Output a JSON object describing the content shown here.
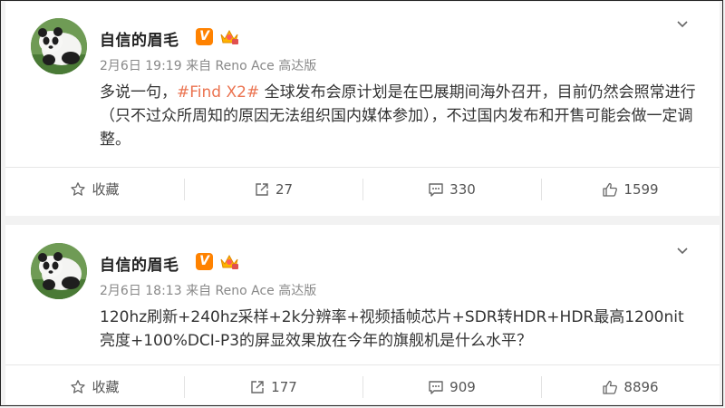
{
  "posts": [
    {
      "author": "自信的眉毛",
      "verified_badge": "V",
      "time": "2月6日 19:19",
      "source": "来自 Reno Ace 高达版",
      "text_prefix": "多说一句，",
      "hashtag": "#Find X2#",
      "text_suffix": " 全球发布会原计划是在巴展期间海外召开，目前仍然会照常进行（只不过众所周知的原因无法组织国内媒体参加），不过国内发布和开售可能会做一定调整。",
      "actions": {
        "favorite_label": "收藏",
        "repost_count": "27",
        "comment_count": "330",
        "like_count": "1599"
      }
    },
    {
      "author": "自信的眉毛",
      "verified_badge": "V",
      "time": "2月6日 18:13",
      "source": "来自 Reno Ace 高达版",
      "text": "120hz刷新+240hz采样+2k分辨率+视频插帧芯片+SDR转HDR+HDR最高1200nit亮度+100%DCI-P3的屏显效果放在今年的旗舰机是什么水平？",
      "actions": {
        "favorite_label": "收藏",
        "repost_count": "177",
        "comment_count": "909",
        "like_count": "8896"
      }
    }
  ],
  "colors": {
    "hashtag": "#eb7350",
    "verified_badge": "#ff8200",
    "background": "#f2f2f2"
  },
  "icons": [
    "star-icon",
    "repost-icon",
    "comment-icon",
    "like-icon",
    "chevron-down-icon",
    "crown-icon"
  ]
}
